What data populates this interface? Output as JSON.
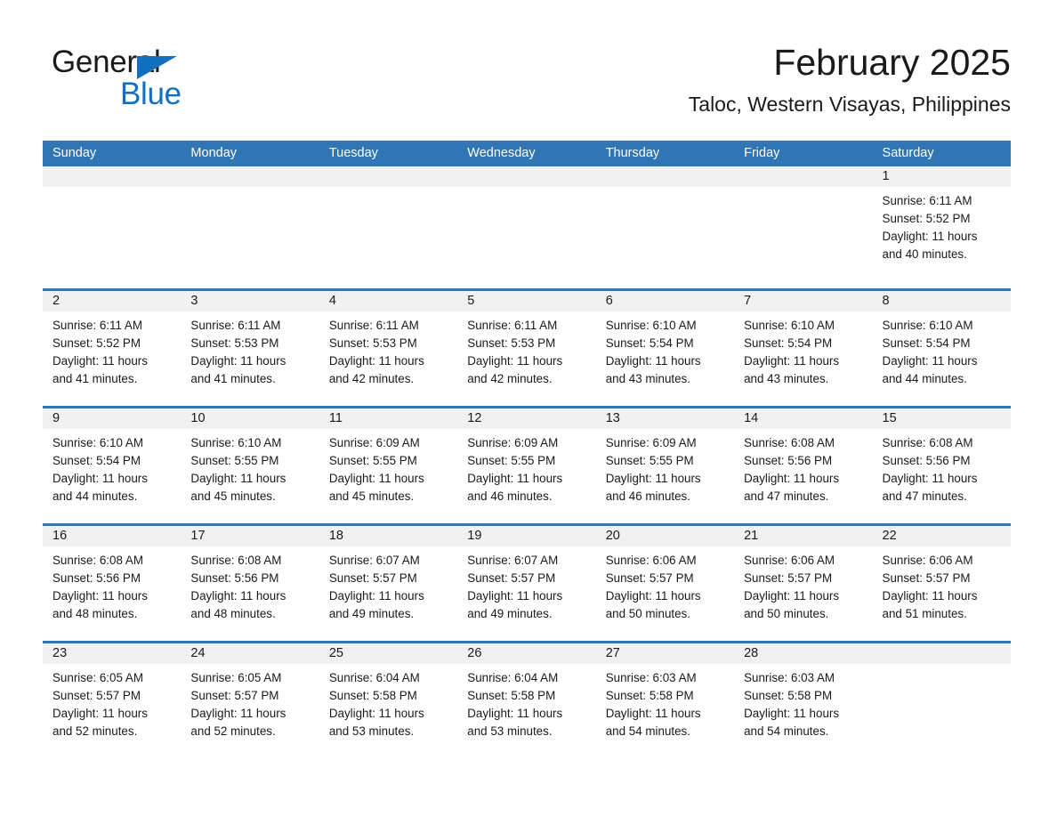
{
  "brand": {
    "line1": "General",
    "line2": "Blue",
    "accent_color": "#1270bf"
  },
  "header": {
    "title": "February 2025",
    "subtitle": "Taloc, Western Visayas, Philippines"
  },
  "theme": {
    "header_blue": "#3075b4",
    "day_band_gray": "#f1f1f1",
    "text": "#1a1a1a"
  },
  "weekdays": [
    "Sunday",
    "Monday",
    "Tuesday",
    "Wednesday",
    "Thursday",
    "Friday",
    "Saturday"
  ],
  "weeks": [
    [
      {
        "empty": true
      },
      {
        "empty": true
      },
      {
        "empty": true
      },
      {
        "empty": true
      },
      {
        "empty": true
      },
      {
        "empty": true
      },
      {
        "day": "1",
        "sunrise": "Sunrise: 6:11 AM",
        "sunset": "Sunset: 5:52 PM",
        "daylight1": "Daylight: 11 hours",
        "daylight2": "and 40 minutes."
      }
    ],
    [
      {
        "day": "2",
        "sunrise": "Sunrise: 6:11 AM",
        "sunset": "Sunset: 5:52 PM",
        "daylight1": "Daylight: 11 hours",
        "daylight2": "and 41 minutes."
      },
      {
        "day": "3",
        "sunrise": "Sunrise: 6:11 AM",
        "sunset": "Sunset: 5:53 PM",
        "daylight1": "Daylight: 11 hours",
        "daylight2": "and 41 minutes."
      },
      {
        "day": "4",
        "sunrise": "Sunrise: 6:11 AM",
        "sunset": "Sunset: 5:53 PM",
        "daylight1": "Daylight: 11 hours",
        "daylight2": "and 42 minutes."
      },
      {
        "day": "5",
        "sunrise": "Sunrise: 6:11 AM",
        "sunset": "Sunset: 5:53 PM",
        "daylight1": "Daylight: 11 hours",
        "daylight2": "and 42 minutes."
      },
      {
        "day": "6",
        "sunrise": "Sunrise: 6:10 AM",
        "sunset": "Sunset: 5:54 PM",
        "daylight1": "Daylight: 11 hours",
        "daylight2": "and 43 minutes."
      },
      {
        "day": "7",
        "sunrise": "Sunrise: 6:10 AM",
        "sunset": "Sunset: 5:54 PM",
        "daylight1": "Daylight: 11 hours",
        "daylight2": "and 43 minutes."
      },
      {
        "day": "8",
        "sunrise": "Sunrise: 6:10 AM",
        "sunset": "Sunset: 5:54 PM",
        "daylight1": "Daylight: 11 hours",
        "daylight2": "and 44 minutes."
      }
    ],
    [
      {
        "day": "9",
        "sunrise": "Sunrise: 6:10 AM",
        "sunset": "Sunset: 5:54 PM",
        "daylight1": "Daylight: 11 hours",
        "daylight2": "and 44 minutes."
      },
      {
        "day": "10",
        "sunrise": "Sunrise: 6:10 AM",
        "sunset": "Sunset: 5:55 PM",
        "daylight1": "Daylight: 11 hours",
        "daylight2": "and 45 minutes."
      },
      {
        "day": "11",
        "sunrise": "Sunrise: 6:09 AM",
        "sunset": "Sunset: 5:55 PM",
        "daylight1": "Daylight: 11 hours",
        "daylight2": "and 45 minutes."
      },
      {
        "day": "12",
        "sunrise": "Sunrise: 6:09 AM",
        "sunset": "Sunset: 5:55 PM",
        "daylight1": "Daylight: 11 hours",
        "daylight2": "and 46 minutes."
      },
      {
        "day": "13",
        "sunrise": "Sunrise: 6:09 AM",
        "sunset": "Sunset: 5:55 PM",
        "daylight1": "Daylight: 11 hours",
        "daylight2": "and 46 minutes."
      },
      {
        "day": "14",
        "sunrise": "Sunrise: 6:08 AM",
        "sunset": "Sunset: 5:56 PM",
        "daylight1": "Daylight: 11 hours",
        "daylight2": "and 47 minutes."
      },
      {
        "day": "15",
        "sunrise": "Sunrise: 6:08 AM",
        "sunset": "Sunset: 5:56 PM",
        "daylight1": "Daylight: 11 hours",
        "daylight2": "and 47 minutes."
      }
    ],
    [
      {
        "day": "16",
        "sunrise": "Sunrise: 6:08 AM",
        "sunset": "Sunset: 5:56 PM",
        "daylight1": "Daylight: 11 hours",
        "daylight2": "and 48 minutes."
      },
      {
        "day": "17",
        "sunrise": "Sunrise: 6:08 AM",
        "sunset": "Sunset: 5:56 PM",
        "daylight1": "Daylight: 11 hours",
        "daylight2": "and 48 minutes."
      },
      {
        "day": "18",
        "sunrise": "Sunrise: 6:07 AM",
        "sunset": "Sunset: 5:57 PM",
        "daylight1": "Daylight: 11 hours",
        "daylight2": "and 49 minutes."
      },
      {
        "day": "19",
        "sunrise": "Sunrise: 6:07 AM",
        "sunset": "Sunset: 5:57 PM",
        "daylight1": "Daylight: 11 hours",
        "daylight2": "and 49 minutes."
      },
      {
        "day": "20",
        "sunrise": "Sunrise: 6:06 AM",
        "sunset": "Sunset: 5:57 PM",
        "daylight1": "Daylight: 11 hours",
        "daylight2": "and 50 minutes."
      },
      {
        "day": "21",
        "sunrise": "Sunrise: 6:06 AM",
        "sunset": "Sunset: 5:57 PM",
        "daylight1": "Daylight: 11 hours",
        "daylight2": "and 50 minutes."
      },
      {
        "day": "22",
        "sunrise": "Sunrise: 6:06 AM",
        "sunset": "Sunset: 5:57 PM",
        "daylight1": "Daylight: 11 hours",
        "daylight2": "and 51 minutes."
      }
    ],
    [
      {
        "day": "23",
        "sunrise": "Sunrise: 6:05 AM",
        "sunset": "Sunset: 5:57 PM",
        "daylight1": "Daylight: 11 hours",
        "daylight2": "and 52 minutes."
      },
      {
        "day": "24",
        "sunrise": "Sunrise: 6:05 AM",
        "sunset": "Sunset: 5:57 PM",
        "daylight1": "Daylight: 11 hours",
        "daylight2": "and 52 minutes."
      },
      {
        "day": "25",
        "sunrise": "Sunrise: 6:04 AM",
        "sunset": "Sunset: 5:58 PM",
        "daylight1": "Daylight: 11 hours",
        "daylight2": "and 53 minutes."
      },
      {
        "day": "26",
        "sunrise": "Sunrise: 6:04 AM",
        "sunset": "Sunset: 5:58 PM",
        "daylight1": "Daylight: 11 hours",
        "daylight2": "and 53 minutes."
      },
      {
        "day": "27",
        "sunrise": "Sunrise: 6:03 AM",
        "sunset": "Sunset: 5:58 PM",
        "daylight1": "Daylight: 11 hours",
        "daylight2": "and 54 minutes."
      },
      {
        "day": "28",
        "sunrise": "Sunrise: 6:03 AM",
        "sunset": "Sunset: 5:58 PM",
        "daylight1": "Daylight: 11 hours",
        "daylight2": "and 54 minutes."
      },
      {
        "empty": true
      }
    ]
  ]
}
